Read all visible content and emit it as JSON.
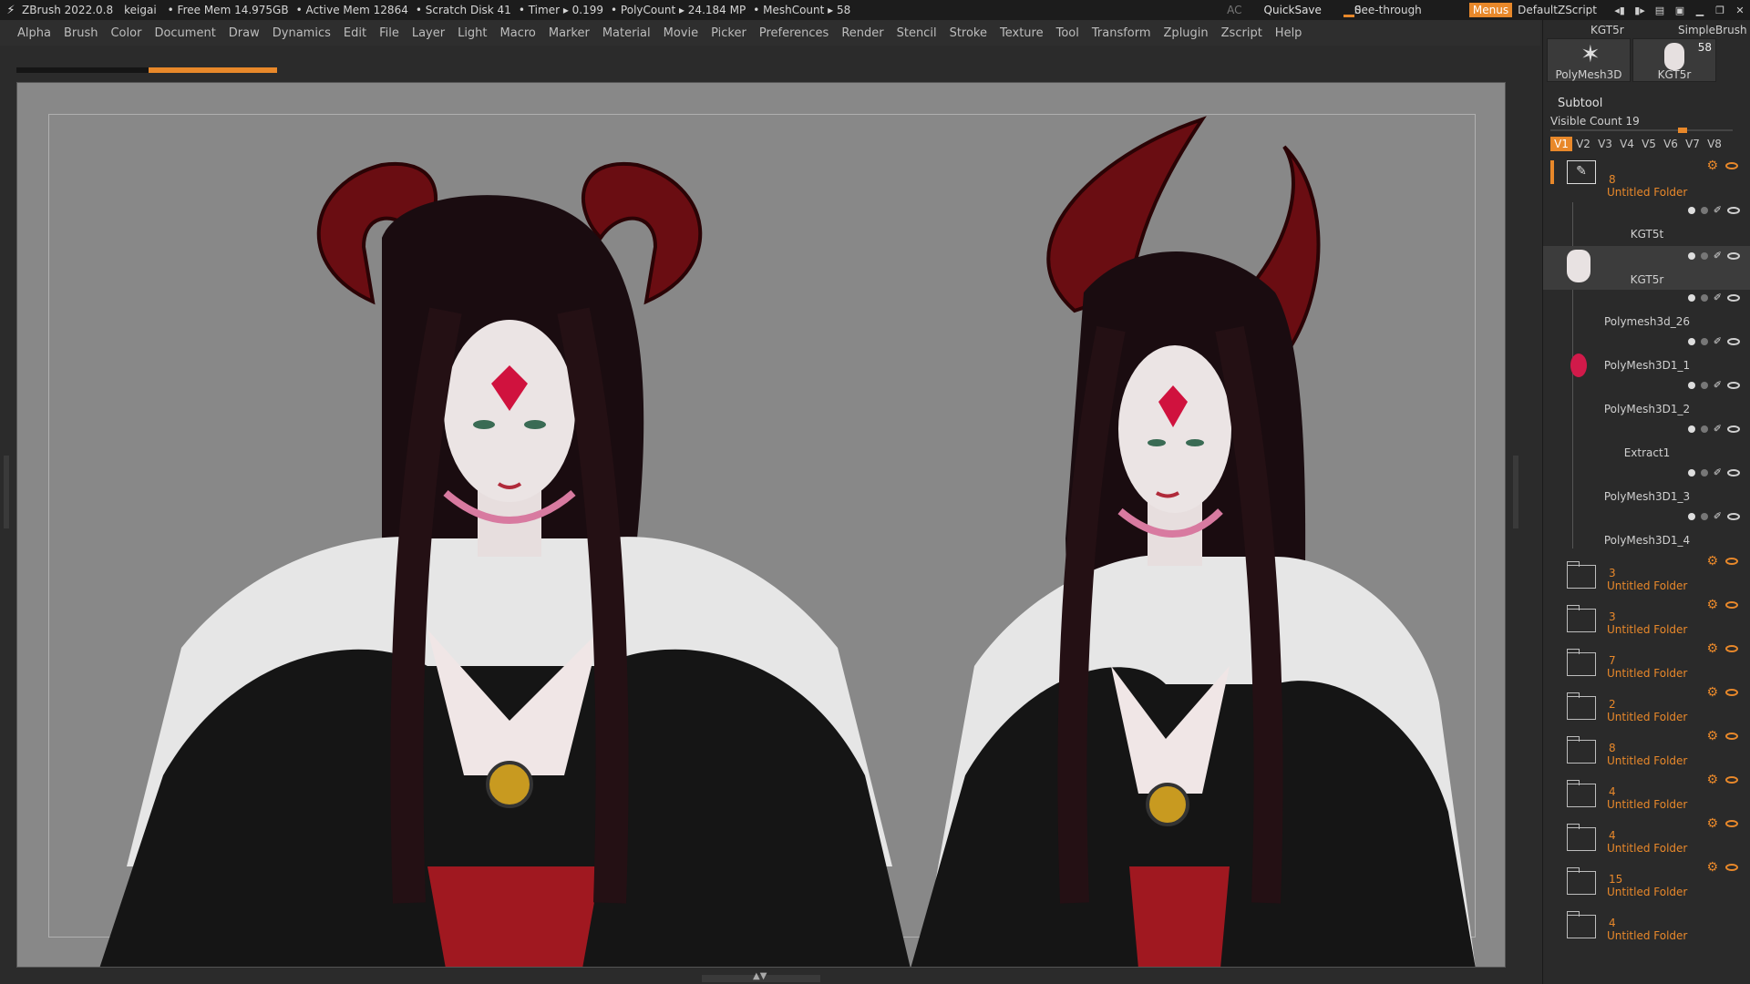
{
  "titlebar": {
    "app": "ZBrush 2022.0.8",
    "user": "keigai",
    "stats": [
      "• Free Mem 14.975GB",
      "• Active Mem 12864",
      "• Scratch Disk 41",
      "• Timer ▸ 0.199",
      "• PolyCount ▸ 24.184 MP",
      "• MeshCount ▸ 58"
    ],
    "ac": "AC",
    "quicksave": "QuickSave",
    "see_through_label": "See-through",
    "see_through_value": "0",
    "see_through_fraction": 0.1,
    "menus": "Menus",
    "script": "DefaultZScript"
  },
  "menubar": [
    "Alpha",
    "Brush",
    "Color",
    "Document",
    "Draw",
    "Dynamics",
    "Edit",
    "File",
    "Layer",
    "Light",
    "Macro",
    "Marker",
    "Material",
    "Movie",
    "Picker",
    "Preferences",
    "Render",
    "Stencil",
    "Stroke",
    "Texture",
    "Tool",
    "Transform",
    "Zplugin",
    "Zscript",
    "Help"
  ],
  "tools": {
    "top_left_label": "KGT5r",
    "top_right_label": "SimpleBrush",
    "left_name": "PolyMesh3D",
    "right_name": "KGT5r",
    "right_count": "58"
  },
  "subtool": {
    "title": "Subtool",
    "visible_count_label": "Visible Count 19",
    "versions": [
      "V1",
      "V2",
      "V3",
      "V4",
      "V5",
      "V6",
      "V7",
      "V8"
    ],
    "active_version": "V1",
    "items": [
      {
        "count": "8",
        "name": "Untitled Folder",
        "kind": "folder-open"
      },
      {
        "name": "KGT5t"
      },
      {
        "name": "KGT5r",
        "selected": true
      },
      {
        "name": "Polymesh3d_26"
      },
      {
        "name": "PolyMesh3D1_1"
      },
      {
        "name": "PolyMesh3D1_2"
      },
      {
        "name": "Extract1"
      },
      {
        "name": "PolyMesh3D1_3"
      },
      {
        "name": "PolyMesh3D1_4"
      }
    ],
    "folders": [
      {
        "count": "3",
        "name": "Untitled Folder"
      },
      {
        "count": "3",
        "name": "Untitled Folder"
      },
      {
        "count": "7",
        "name": "Untitled Folder"
      },
      {
        "count": "2",
        "name": "Untitled Folder"
      },
      {
        "count": "8",
        "name": "Untitled Folder"
      },
      {
        "count": "4",
        "name": "Untitled Folder"
      },
      {
        "count": "4",
        "name": "Untitled Folder"
      },
      {
        "count": "15",
        "name": "Untitled Folder"
      },
      {
        "count": "4",
        "name": "Untitled Folder"
      }
    ]
  },
  "colors": {
    "accent": "#e8882a",
    "viewport_bg": "#888888",
    "panel_bg": "#2a2a2a"
  }
}
